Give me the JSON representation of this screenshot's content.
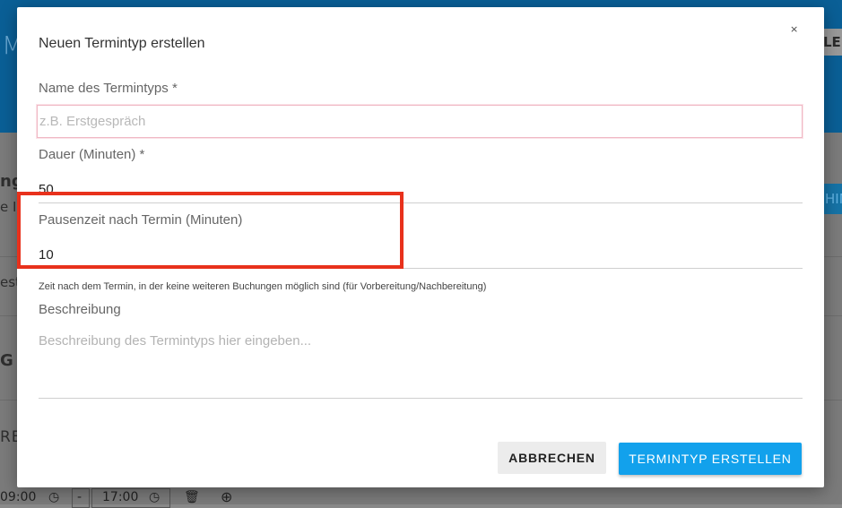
{
  "background": {
    "logo_fragment": "M",
    "header_button_fragment": "LEF",
    "left_fragments": [
      "ng",
      "e Ih",
      "est",
      "G",
      "RE"
    ],
    "right_button_fragment": "HIN",
    "row": {
      "start_time": "09:00",
      "separator": "-",
      "end_time": "17:00"
    }
  },
  "modal": {
    "title": "Neuen Termintyp erstellen",
    "close_symbol": "×",
    "name_field": {
      "label": "Name des Termintyps *",
      "placeholder": "z.B. Erstgespräch",
      "value": ""
    },
    "duration_field": {
      "label": "Dauer (Minuten) *",
      "value": "50"
    },
    "pause_field": {
      "label": "Pausenzeit nach Termin (Minuten)",
      "value": "10",
      "helper": "Zeit nach dem Termin, in der keine weiteren Buchungen möglich sind (für Vorbereitung/Nachbereitung)"
    },
    "description_field": {
      "label": "Beschreibung",
      "placeholder": "Beschreibung des Termintyps hier eingeben..."
    },
    "buttons": {
      "cancel": "ABBRECHEN",
      "create": "TERMINTYP ERSTELLEN"
    }
  },
  "colors": {
    "primary": "#12a1ec",
    "highlight": "#e8311c",
    "header_bg": "#0a5f96",
    "invalid_border": "#f0b8c4"
  }
}
